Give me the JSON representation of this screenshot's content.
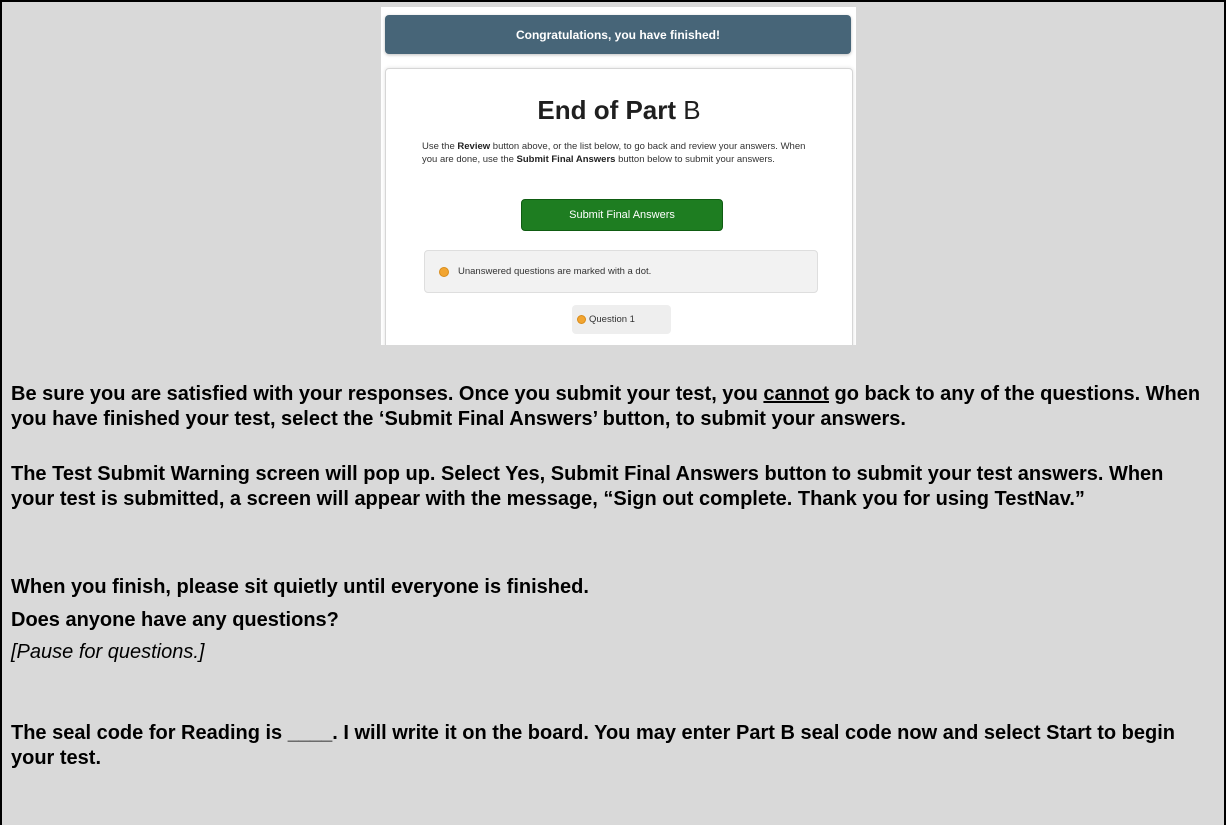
{
  "screenshot": {
    "banner": "Congratulations, you have finished!",
    "title_prefix": "End of Part",
    "title_letter": "B",
    "instructions": {
      "p1": "Use the ",
      "review": "Review",
      "p2": " button above, or the list below, to go back and review your answers. When you are done, use the ",
      "submit_bold": "Submit Final Answers",
      "p3": " button below to submit your answers."
    },
    "submit_label": "Submit Final Answers",
    "legend_text": "Unanswered questions are marked with a dot.",
    "question_label": "Question 1",
    "dot_color": "#f2a531",
    "banner_color": "#476578",
    "button_color": "#1e7d21"
  },
  "body": {
    "p1_a": "Be sure you are satisfied with your responses. Once you submit your test, you ",
    "p1_u": "cannot",
    "p1_b": " go back to any of the questions. When you have finished your test, select the ‘Submit Final Answers’ button, to submit your answers.",
    "p2": "The Test Submit Warning screen will pop up. Select Yes, Submit Final Answers button to submit your test answers. When your test is submitted, a screen will appear with the message, “Sign out complete. Thank you for using TestNav.”",
    "p3": "When you finish, please sit quietly until everyone is finished.",
    "p4": "Does anyone have any questions?",
    "p5": "[Pause for questions.]",
    "p6": "The seal code for Reading is ____. I will write it on the board. You may enter Part B seal code now and select Start to begin your test."
  }
}
